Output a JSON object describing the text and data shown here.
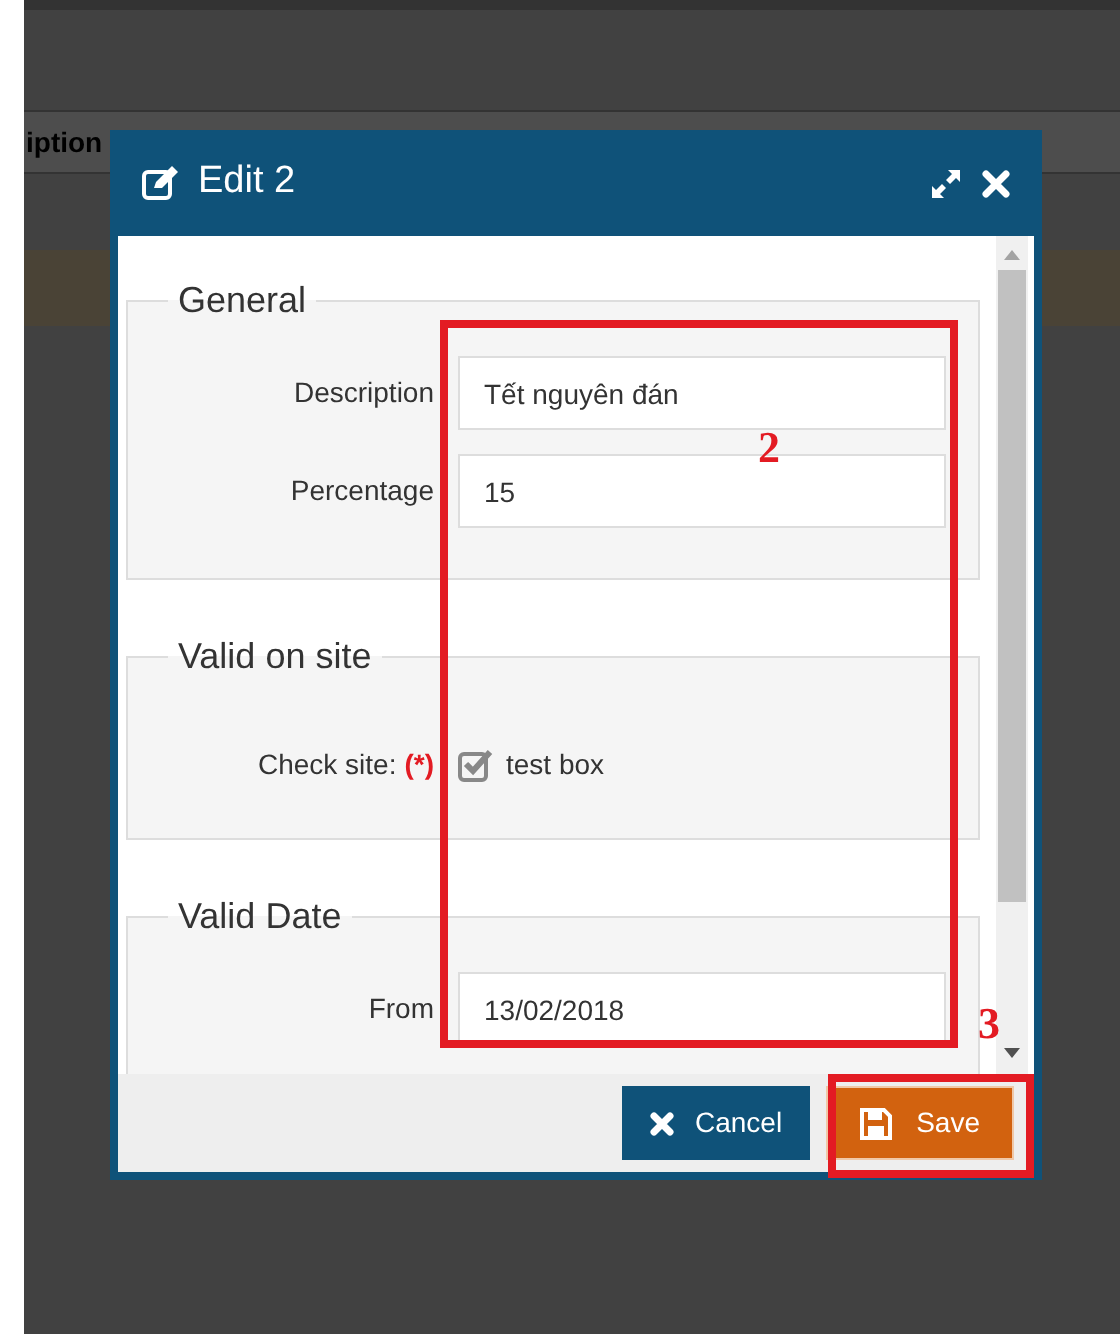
{
  "background_table": {
    "column_1": "iption"
  },
  "dialog": {
    "title": "Edit 2",
    "sections": [
      {
        "legend": "General",
        "fields": [
          {
            "kind": "text",
            "label": "Description",
            "value": "Tết nguyên đán"
          },
          {
            "kind": "text",
            "label": "Percentage",
            "value": "15"
          }
        ]
      },
      {
        "legend": "Valid on site",
        "fields": [
          {
            "kind": "checkbox",
            "label": "Check site:",
            "required_mark": "(*)",
            "option": "test box",
            "checked": true
          }
        ]
      },
      {
        "legend": "Valid Date",
        "fields": [
          {
            "kind": "text",
            "label": "From",
            "value": "13/02/2018"
          }
        ]
      }
    ],
    "buttons": [
      {
        "kind": "cancel",
        "label": "Cancel"
      },
      {
        "kind": "save",
        "label": "Save"
      }
    ]
  },
  "annotations": [
    {
      "label": "2"
    },
    {
      "label": "3"
    }
  ]
}
